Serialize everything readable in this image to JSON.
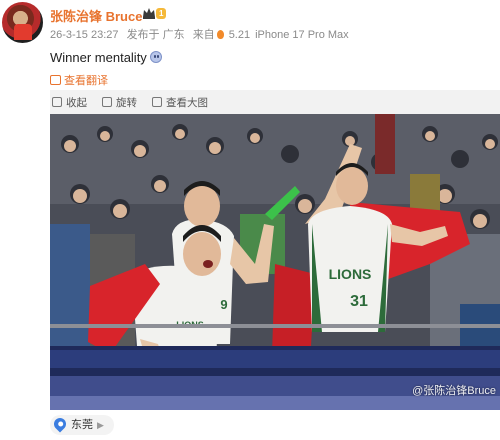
{
  "post": {
    "username": "张陈治锋 Bruce",
    "vip_badge": "1",
    "meta": {
      "date": "26-3-15 23:27",
      "published_from": "发布于 广东",
      "source_prefix": "来自",
      "heat_value": "5.21",
      "device": "iPhone 17 Pro Max"
    },
    "text": "Winner mentality",
    "translate_label": "查看翻译"
  },
  "image_toolbar": {
    "collect": "收起",
    "rotate": "旋转",
    "view_large": "查看大图"
  },
  "photo": {
    "jersey_number_front": "31",
    "jersey_number_middle": "9",
    "jersey_team_text": "LIONS",
    "watermark": "@张陈治锋Bruce"
  },
  "location": {
    "name": "东莞"
  },
  "colors": {
    "accent": "#e8732e",
    "location_pin": "#3b7de0",
    "banner_red": "#d8242b"
  }
}
